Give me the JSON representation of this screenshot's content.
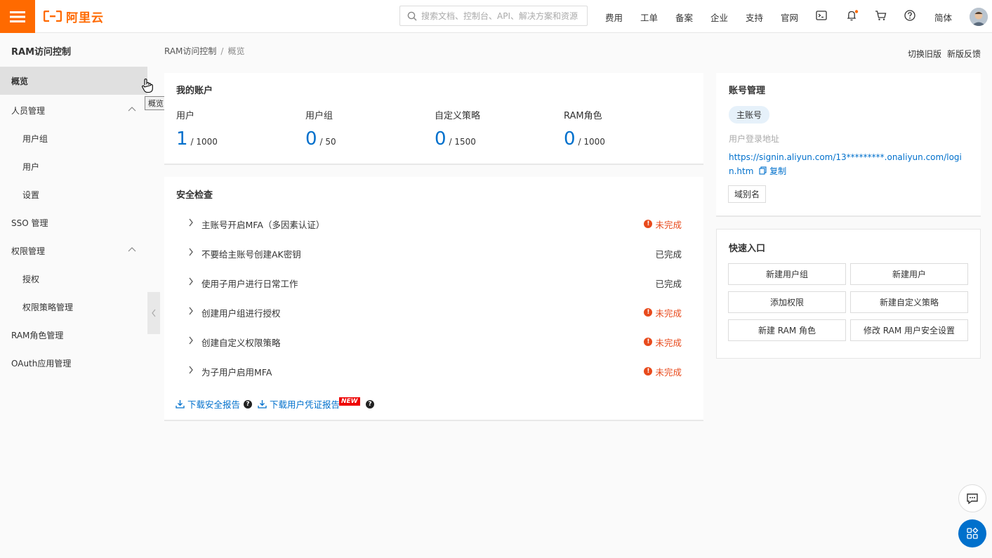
{
  "header": {
    "logo_text": "阿里云",
    "search_placeholder": "搜索文档、控制台、API、解决方案和资源",
    "nav": [
      "费用",
      "工单",
      "备案",
      "企业",
      "支持",
      "官网"
    ],
    "lang": "简体",
    "accent": "#ff6a00"
  },
  "sidebar": {
    "title": "RAM访问控制",
    "items": [
      {
        "label": "概览"
      },
      {
        "label": "人员管理"
      },
      {
        "label": "用户组"
      },
      {
        "label": "用户"
      },
      {
        "label": "设置"
      },
      {
        "label": "SSO 管理"
      },
      {
        "label": "权限管理"
      },
      {
        "label": "授权"
      },
      {
        "label": "权限策略管理"
      },
      {
        "label": "RAM角色管理"
      },
      {
        "label": "OAuth应用管理"
      }
    ],
    "tooltip": "概览"
  },
  "breadcrumb": {
    "root": "RAM访问控制",
    "sep": "/",
    "current": "概览"
  },
  "top_links": {
    "switch_old": "切换旧版",
    "feedback": "新版反馈"
  },
  "account": {
    "title": "我的账户",
    "stats": [
      {
        "name": "用户",
        "value": "1",
        "total": "/ 1000"
      },
      {
        "name": "用户组",
        "value": "0",
        "total": "/ 50"
      },
      {
        "name": "自定义策略",
        "value": "0",
        "total": "/ 1500"
      },
      {
        "name": "RAM角色",
        "value": "0",
        "total": "/ 1000"
      }
    ]
  },
  "security": {
    "title": "安全检查",
    "items": [
      {
        "text": "主账号开启MFA（多因素认证）",
        "status": "未完成"
      },
      {
        "text": "不要给主账号创建AK密钥",
        "status": "已完成"
      },
      {
        "text": "使用子用户进行日常工作",
        "status": "已完成"
      },
      {
        "text": "创建用户组进行授权",
        "status": "未完成"
      },
      {
        "text": "创建自定义权限策略",
        "status": "未完成"
      },
      {
        "text": "为子用户启用MFA",
        "status": "未完成"
      }
    ],
    "download_security": "下载安全报告",
    "download_credentials": "下载用户凭证报告",
    "new_badge": "NEW"
  },
  "account_mgmt": {
    "title": "账号管理",
    "tag": "主账号",
    "login_label": "用户登录地址",
    "login_url": "https://signin.aliyun.com/13*********.onaliyun.com/login.htm",
    "copy": "复制",
    "alias": "域别名"
  },
  "quick": {
    "title": "快速入口",
    "buttons": [
      "新建用户组",
      "新建用户",
      "添加权限",
      "新建自定义策略",
      "新建 RAM 角色",
      "修改 RAM 用户安全设置"
    ]
  }
}
